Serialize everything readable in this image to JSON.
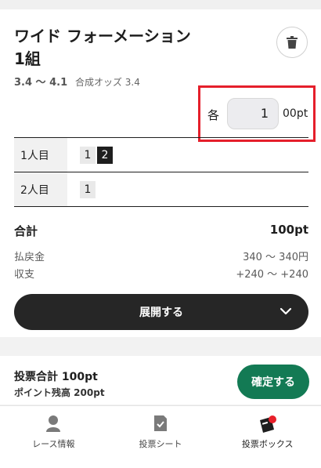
{
  "ticket": {
    "title_line1": "ワイド フォーメーション",
    "title_line2": "1組",
    "odds_range": "3.4 〜 4.1",
    "combined_odds": "合成オッズ 3.4"
  },
  "bet": {
    "each_label": "各",
    "amount_value": "1",
    "unit": "00pt"
  },
  "selection": {
    "rows": [
      {
        "label": "1人目",
        "numbers": [
          "1",
          "2"
        ]
      },
      {
        "label": "2人目",
        "numbers": [
          "1"
        ]
      }
    ]
  },
  "summary": {
    "total_label": "合計",
    "total_value": "100pt",
    "payout_label": "払戻金",
    "payout_value": "340 〜 340円",
    "balance_label": "収支",
    "balance_value": "+240 〜 +240"
  },
  "expand_button": {
    "label": "展開する"
  },
  "footer": {
    "bet_total": "投票合計 100pt",
    "points_balance": "ポイント残高 200pt",
    "confirm_label": "確定する"
  },
  "tabs": [
    {
      "label": "レース情報",
      "icon": "person-icon"
    },
    {
      "label": "投票シート",
      "icon": "sheet-icon"
    },
    {
      "label": "投票ボックス",
      "icon": "ticket-box-icon"
    }
  ],
  "colors": {
    "accent_green": "#137a54",
    "highlight_red": "#e51f2b",
    "dark_button": "#262626",
    "badge_red": "#e8202a"
  }
}
